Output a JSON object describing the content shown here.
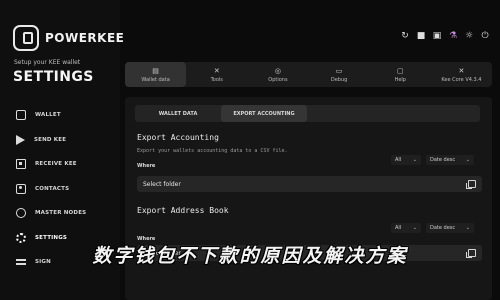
{
  "app": {
    "brand": "POWERKEE",
    "subtitle": "Setup your KEE wallet",
    "page_title": "SETTINGS"
  },
  "sidebar": {
    "items": [
      {
        "label": "WALLET",
        "icon": "wallet-icon"
      },
      {
        "label": "SEND KEE",
        "icon": "send-icon"
      },
      {
        "label": "RECEIVE KEE",
        "icon": "receive-icon"
      },
      {
        "label": "CONTACTS",
        "icon": "contacts-icon"
      },
      {
        "label": "MASTER NODES",
        "icon": "master-nodes-icon"
      },
      {
        "label": "SETTINGS",
        "icon": "gear-icon",
        "active": true
      },
      {
        "label": "SIGN",
        "icon": "sign-icon"
      }
    ]
  },
  "top_icons": [
    "refresh-icon",
    "gift-icon",
    "lock-icon",
    "flask-icon",
    "sun-icon",
    "power-icon"
  ],
  "tabs": [
    {
      "label": "Wallet data",
      "icon": "database-icon",
      "active": true
    },
    {
      "label": "Tools",
      "icon": "tools-icon"
    },
    {
      "label": "Options",
      "icon": "options-icon"
    },
    {
      "label": "Debug",
      "icon": "debug-icon"
    },
    {
      "label": "Help",
      "icon": "help-icon"
    },
    {
      "label": "Kee Core V4.3.4",
      "icon": "core-icon"
    }
  ],
  "subtabs": [
    {
      "label": "WALLET DATA"
    },
    {
      "label": "EXPORT ACCOUNTING",
      "active": true
    }
  ],
  "export_accounting": {
    "title": "Export Accounting",
    "description": "Export your wallets accounting data to a CSV file.",
    "where_label": "Where",
    "filter_value": "All",
    "sort_value": "Date desc",
    "field_value": "Select folder"
  },
  "export_address_book": {
    "title": "Export Address Book",
    "where_label": "Where",
    "filter_value": "All",
    "sort_value": "Date desc",
    "field_value": "Select folder"
  },
  "overlay_caption": "数字钱包不下款的原因及解决方案",
  "colors": {
    "background": "#0b0b0b",
    "panel": "#161616",
    "active_tab": "#323232",
    "text": "#e6e6e6"
  }
}
